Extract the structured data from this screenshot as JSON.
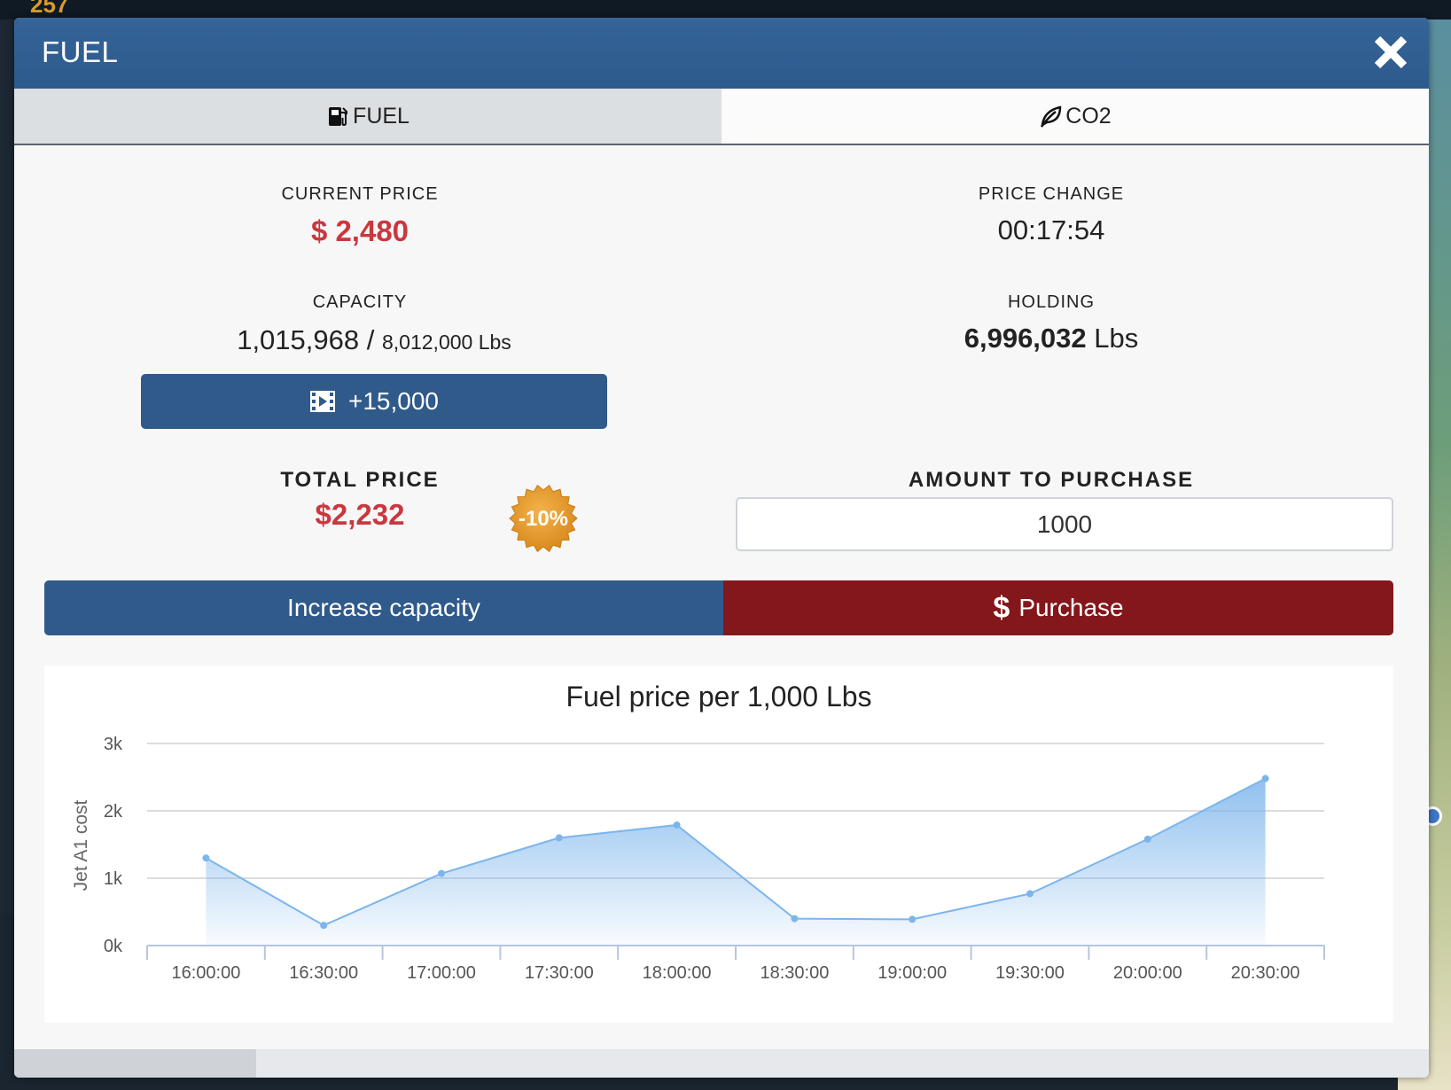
{
  "background": {
    "topbar_text": "257"
  },
  "modal": {
    "title": "FUEL"
  },
  "tabs": [
    {
      "label": "FUEL",
      "icon": "fuel-pump-icon",
      "active": true
    },
    {
      "label": "CO2",
      "icon": "leaf-icon",
      "active": false
    }
  ],
  "current_price": {
    "label": "CURRENT PRICE",
    "value": "$ 2,480"
  },
  "price_change": {
    "label": "PRICE CHANGE",
    "value": "00:17:54"
  },
  "capacity": {
    "label": "CAPACITY",
    "current": "1,015,968",
    "separator": "/",
    "max": "8,012,000 Lbs"
  },
  "holding": {
    "label": "HOLDING",
    "value": "6,996,032",
    "unit": "Lbs"
  },
  "ad_button": {
    "label": "+15,000",
    "icon": "video-icon"
  },
  "total_price": {
    "label": "TOTAL PRICE",
    "value": "$2,232"
  },
  "discount_badge": {
    "text": "-10%"
  },
  "amount": {
    "label": "AMOUNT TO PURCHASE",
    "value": "1000"
  },
  "actions": {
    "increase_label": "Increase capacity",
    "purchase_label": "Purchase",
    "purchase_icon": "$"
  },
  "colors": {
    "primary": "#2f5a8a",
    "danger": "#84171b",
    "price_red": "#c9383e",
    "series": "#7cb5ec"
  },
  "chart_data": {
    "type": "area",
    "title": "Fuel price per 1,000 Lbs",
    "xlabel": "",
    "ylabel": "Jet A1 cost",
    "categories": [
      "16:00:00",
      "16:30:00",
      "17:00:00",
      "17:30:00",
      "18:00:00",
      "18:30:00",
      "19:00:00",
      "19:30:00",
      "20:00:00",
      "20:30:00"
    ],
    "y_ticks": [
      "0k",
      "1k",
      "2k",
      "3k"
    ],
    "ylim": [
      0,
      3000
    ],
    "x_positions": [
      0,
      0.5,
      1,
      1.5,
      2,
      2.5,
      3,
      3.5,
      4,
      4.5
    ],
    "point_x": [
      0,
      0.5,
      1,
      1.5,
      2,
      2.5,
      3,
      3.5,
      4,
      4.5
    ],
    "series": [
      {
        "values": [
          1300,
          300,
          1070,
          1600,
          1790,
          400,
          390,
          770,
          1580,
          2480
        ]
      }
    ],
    "grid": true,
    "legend": "none"
  }
}
